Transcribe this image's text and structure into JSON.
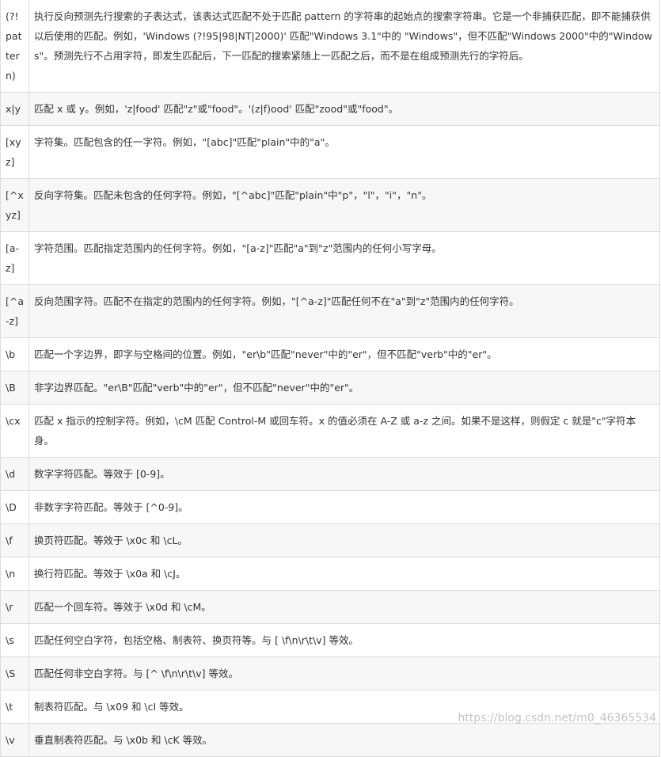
{
  "table": {
    "rows": [
      {
        "symbol": "(?!pattern)",
        "description": "执行反向预测先行搜索的子表达式，该表达式匹配不处于匹配 pattern 的字符串的起始点的搜索字符串。它是一个非捕获匹配，即不能捕获供以后使用的匹配。例如，'Windows (?!95|98|NT|2000)' 匹配\"Windows 3.1\"中的 \"Windows\"，但不匹配\"Windows 2000\"中的\"Windows\"。预测先行不占用字符，即发生匹配后，下一匹配的搜索紧随上一匹配之后，而不是在组成预测先行的字符后。"
      },
      {
        "symbol": "x|y",
        "description": "匹配 x 或 y。例如，'z|food' 匹配\"z\"或\"food\"。'(z|f)ood' 匹配\"zood\"或\"food\"。"
      },
      {
        "symbol": "[xyz]",
        "description": "字符集。匹配包含的任一字符。例如，\"[abc]\"匹配\"plain\"中的\"a\"。"
      },
      {
        "symbol": "[^xyz]",
        "description": "反向字符集。匹配未包含的任何字符。例如，\"[^abc]\"匹配\"plain\"中\"p\"，\"l\"，\"i\"，\"n\"。"
      },
      {
        "symbol": "[a-z]",
        "description": "字符范围。匹配指定范围内的任何字符。例如，\"[a-z]\"匹配\"a\"到\"z\"范围内的任何小写字母。"
      },
      {
        "symbol": "[^a-z]",
        "description": "反向范围字符。匹配不在指定的范围内的任何字符。例如，\"[^a-z]\"匹配任何不在\"a\"到\"z\"范围内的任何字符。"
      },
      {
        "symbol": "\\b",
        "description": "匹配一个字边界，即字与空格间的位置。例如，\"er\\b\"匹配\"never\"中的\"er\"，但不匹配\"verb\"中的\"er\"。"
      },
      {
        "symbol": "\\B",
        "description": "非字边界匹配。\"er\\B\"匹配\"verb\"中的\"er\"，但不匹配\"never\"中的\"er\"。"
      },
      {
        "symbol": "\\cx",
        "description": "匹配 x 指示的控制字符。例如，\\cM 匹配 Control-M 或回车符。x 的值必须在 A-Z 或 a-z 之间。如果不是这样，则假定 c 就是\"c\"字符本身。"
      },
      {
        "symbol": "\\d",
        "description": "数字字符匹配。等效于 [0-9]。"
      },
      {
        "symbol": "\\D",
        "description": "非数字字符匹配。等效于 [^0-9]。"
      },
      {
        "symbol": "\\f",
        "description": "换页符匹配。等效于 \\x0c 和 \\cL。"
      },
      {
        "symbol": "\\n",
        "description": "换行符匹配。等效于 \\x0a 和 \\cJ。"
      },
      {
        "symbol": "\\r",
        "description": "匹配一个回车符。等效于 \\x0d 和 \\cM。"
      },
      {
        "symbol": "\\s",
        "description": "匹配任何空白字符，包括空格、制表符、换页符等。与 [ \\f\\n\\r\\t\\v] 等效。"
      },
      {
        "symbol": "\\S",
        "description": "匹配任何非空白字符。与 [^ \\f\\n\\r\\t\\v] 等效。"
      },
      {
        "symbol": "\\t",
        "description": "制表符匹配。与 \\x09 和 \\cI 等效。"
      },
      {
        "symbol": "\\v",
        "description": "垂直制表符匹配。与 \\x0b 和 \\cK 等效。"
      }
    ]
  },
  "watermark": "https://blog.csdn.net/m0_46365534"
}
